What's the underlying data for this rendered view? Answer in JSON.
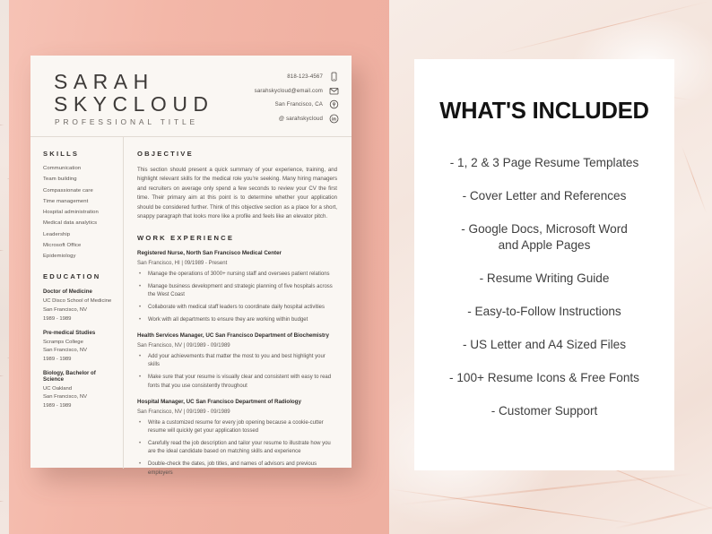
{
  "background": {
    "left_color": "#f2b5a7",
    "right_texture": "marble",
    "marble_vein_color": "#d67c56"
  },
  "resume": {
    "card_color": "#faf7f3",
    "header": {
      "first_name": "SARAH",
      "last_name": "SKYCLOUD",
      "professional_title": "PROFESSIONAL TITLE",
      "contacts": [
        {
          "icon": "phone-icon",
          "text": "818-123-4567"
        },
        {
          "icon": "email-icon",
          "text": "sarahskycloud@email.com"
        },
        {
          "icon": "location-pin-icon",
          "text": "San Francisco, CA"
        },
        {
          "icon": "linkedin-icon",
          "text": "@ sarahskycloud"
        }
      ]
    },
    "skills": {
      "heading": "SKILLS",
      "items": [
        "Communication",
        "Team building",
        "Compassionate care",
        "Time management",
        "Hospital administration",
        "Medical data analytics",
        "Leadership",
        "Microsoft Office",
        "Epidemiology"
      ]
    },
    "education": {
      "heading": "EDUCATION",
      "entries": [
        {
          "degree": "Doctor of Medicine",
          "school": "UC Disco School of Medicine",
          "location": "San Francisco, NV",
          "dates": "1989 - 1989"
        },
        {
          "degree": "Pre-medical Studies",
          "school": "Scramps College",
          "location": "San Francisco, NV",
          "dates": "1989 - 1989"
        },
        {
          "degree": "Biology, Bachelor of Science",
          "school": "UC Oakland",
          "location": "San Francisco, NV",
          "dates": "1989 - 1989"
        }
      ]
    },
    "objective": {
      "heading": "OBJECTIVE",
      "body": "This section should present a quick summary of your experience, training, and highlight relevant skills for the medical role you're seeking. Many hiring managers and recruiters on average only spend a few seconds to review your CV the first time. Their primary aim at this point is to determine whether your application should be considered further. Think of this objective section as a place for a short, snappy paragraph that looks more like a profile and feels like an elevator pitch."
    },
    "work_experience": {
      "heading": "WORK EXPERIENCE",
      "jobs": [
        {
          "title": "Registered Nurse, North San Francisco Medical Center",
          "meta": "San Francisco, HI  |  09/1989 - Present",
          "bullets": [
            "Manage the operations of 3000+ nursing staff and oversees patient relations",
            "Manage business development and strategic planning of five hospitals across the West Coast",
            "Collaborate with medical staff leaders to coordinate daily hospital activities",
            "Work with all departments to ensure they are working within budget"
          ]
        },
        {
          "title": "Health Services Manager, UC San Francisco Department of Biochemistry",
          "meta": "San Francisco, NV  |  09/1989 - 09/1989",
          "bullets": [
            "Add your achievements that matter the most to you and best highlight your skills",
            "Make sure that your resume is visually clear and consistent with easy to read fonts that you use consistently throughout"
          ]
        },
        {
          "title": "Hospital Manager, UC San Francisco Department of Radiology",
          "meta": "San Francisco, NV  |  09/1989 - 09/1989",
          "bullets": [
            "Write a customized resume for every job opening because a cookie-cutter resume will quickly get your application tossed",
            "Carefully read the job description and tailor your resume to illustrate how you are the ideal candidate based on matching skills and experience",
            "Double-check the dates, job titles, and names of advisors and previous employers"
          ]
        }
      ]
    }
  },
  "included_panel": {
    "title": "WHAT'S INCLUDED",
    "items": [
      "- 1, 2 & 3 Page Resume Templates",
      "- Cover Letter and References",
      "- Google Docs, Microsoft Word\nand Apple Pages",
      "- Resume Writing Guide",
      "- Easy-to-Follow Instructions",
      "- US Letter and A4 Sized Files",
      "- 100+ Resume Icons & Free Fonts",
      "- Customer Support"
    ]
  }
}
